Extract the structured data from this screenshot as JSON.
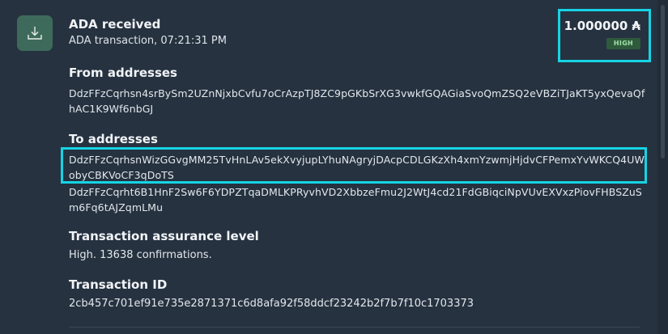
{
  "transaction": {
    "title": "ADA received",
    "subtitle": "ADA transaction, 07:21:31 PM",
    "icon": "receive-download-icon",
    "amount": "1.000000 ₳",
    "badge": "HIGH"
  },
  "from": {
    "heading": "From addresses",
    "addresses": [
      "DdzFFzCqrhsn4srBySm2UZnNjxbCvfu7oCrAzpTJ8ZC9pGKbSrXG3vwkfGQAGiaSvoQmZSQ2eVBZiTJaKT5yxQevaQfhAC1K9Wf6nbGJ"
    ]
  },
  "to": {
    "heading": "To addresses",
    "addresses": [
      "DdzFFzCqrhsnWizGGvgMM25TvHnLAv5ekXvyjupLYhuNAgryjDAcpCDLGKzXh4xmYzwmjHjdvCFPemxYvWKCQ4UWobyCBKVoCF3qDoTS",
      "DdzFFzCqrht6B1HnF2Sw6F6YDPZTqaDMLKPRyvhVD2XbbzeFmu2J2WtJ4cd21FdGBiqciNpVUvEXVxzPiovFHBSZuSm6Fq6tAJZqmLMu"
    ]
  },
  "assurance": {
    "heading": "Transaction assurance level",
    "value": "High. 13638 confirmations."
  },
  "txid": {
    "heading": "Transaction ID",
    "value": "2cb457c701ef91e735e2871371c6d8afa92f58ddcf23242b2f7b7f10c1703373"
  },
  "colors": {
    "background": "#263240",
    "accent_highlight": "#16d4e4",
    "icon_bg": "#3d6a5a",
    "badge_bg": "#2f5a3c"
  }
}
